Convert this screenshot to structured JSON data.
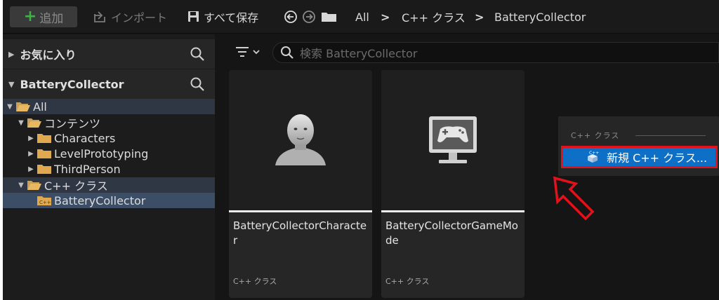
{
  "toolbar": {
    "add_label": "追加",
    "import_label": "インポート",
    "save_all_label": "すべて保存",
    "breadcrumb": [
      "All",
      "C++ クラス",
      "BatteryCollector"
    ],
    "separator": ">"
  },
  "left_panel": {
    "favorites_label": "お気に入り",
    "collection_label": "BatteryCollector",
    "tree": [
      {
        "label": "All",
        "expanded": true
      },
      {
        "label": "コンテンツ",
        "expanded": true
      },
      {
        "label": "Characters",
        "expanded": false
      },
      {
        "label": "LevelPrototyping",
        "expanded": false
      },
      {
        "label": "ThirdPerson",
        "expanded": false
      },
      {
        "label": "C++ クラス",
        "expanded": true
      },
      {
        "label": "BatteryCollector",
        "selected": true
      }
    ]
  },
  "content": {
    "search_placeholder": "検索 BatteryCollector",
    "cards": [
      {
        "title": "BatteryCollectorCharacter",
        "type": "C++ クラス",
        "icon": "character-icon"
      },
      {
        "title": "BatteryCollectorGameMode",
        "type": "C++ クラス",
        "icon": "gamemode-icon"
      }
    ]
  },
  "context_menu": {
    "heading": "C++ クラス",
    "item_label": "新規 C++ クラス..."
  },
  "colors": {
    "accent_green": "#3fb14a",
    "selection_blue": "#0e6fc7",
    "highlight_red": "#e3111a"
  }
}
